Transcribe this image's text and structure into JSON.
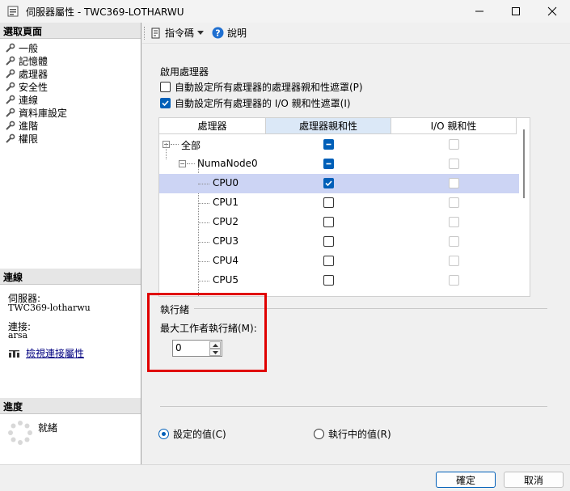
{
  "window": {
    "title": "伺服器屬性 - TWC369-LOTHARWU"
  },
  "left": {
    "select_page_title": "選取頁面",
    "pages": [
      "一般",
      "記憶體",
      "處理器",
      "安全性",
      "連線",
      "資料庫設定",
      "進階",
      "權限"
    ],
    "connection_title": "連線",
    "server_label": "伺服器:",
    "server_value": "TWC369-lotharwu",
    "connection_label": "連接:",
    "connection_value": "arsa",
    "view_connection_link": "檢視連接屬性",
    "progress_title": "進度",
    "progress_status": "就緒"
  },
  "toolbar": {
    "script_label": "指令碼",
    "help_label": "說明"
  },
  "processors": {
    "group_title": "啟用處理器",
    "auto_processor_affinity": {
      "label": "自動設定所有處理器的處理器親和性遮罩(P)",
      "checked": false
    },
    "auto_io_affinity": {
      "label": "自動設定所有處理器的 I/O 親和性遮罩(I)",
      "checked": true
    },
    "columns": [
      "處理器",
      "處理器親和性",
      "I/O 親和性"
    ],
    "rows": [
      {
        "label": "全部",
        "affinity": "indeterminate",
        "io": "disabled"
      },
      {
        "label": "NumaNode0",
        "affinity": "indeterminate",
        "io": "disabled"
      },
      {
        "label": "CPU0",
        "affinity": "checked",
        "io": "disabled"
      },
      {
        "label": "CPU1",
        "affinity": "unchecked",
        "io": "disabled"
      },
      {
        "label": "CPU2",
        "affinity": "unchecked",
        "io": "disabled"
      },
      {
        "label": "CPU3",
        "affinity": "unchecked",
        "io": "disabled"
      },
      {
        "label": "CPU4",
        "affinity": "unchecked",
        "io": "disabled"
      },
      {
        "label": "CPU5",
        "affinity": "unchecked",
        "io": "disabled"
      }
    ]
  },
  "threads": {
    "group_title": "執行緒",
    "max_worker_label": "最大工作者執行緒(M):",
    "max_worker_value": "0"
  },
  "view_options": {
    "configured": {
      "label": "設定的值(C)",
      "selected": true
    },
    "running": {
      "label": "執行中的值(R)",
      "selected": false
    }
  },
  "buttons": {
    "ok": "確定",
    "cancel": "取消"
  },
  "colors": {
    "accent": "#005fb8",
    "selected_row": "#ccd4f4",
    "highlight": "#e00000"
  }
}
